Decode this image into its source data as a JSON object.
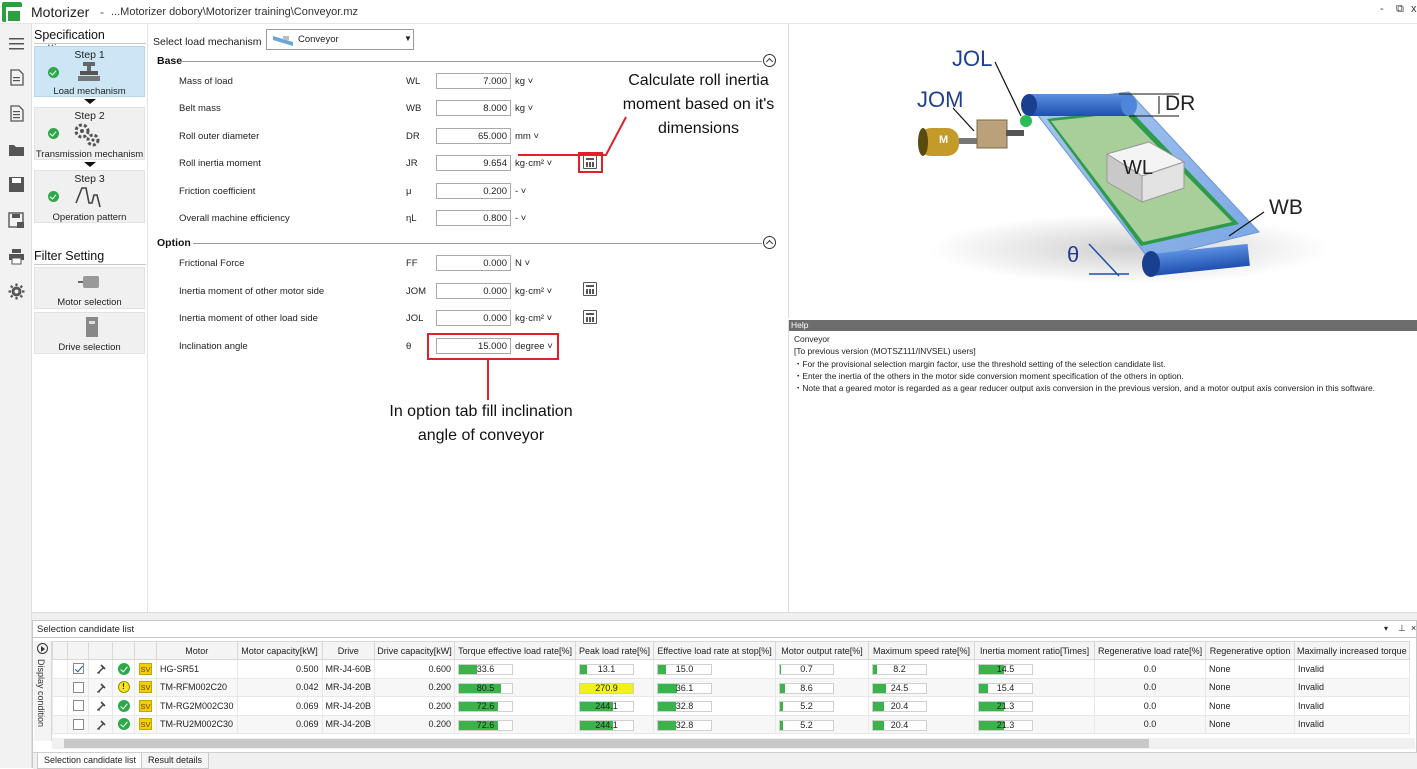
{
  "window": {
    "app_title": "Motorizer",
    "separator": "-",
    "file_path": "...Motorizer dobory\\Motorizer training\\Conveyor.mz",
    "min_label": "-",
    "restore_label": "⧉",
    "close_label": "x"
  },
  "nav": {
    "spec_heading": "Specification settings",
    "steps": [
      {
        "title": "Step 1",
        "label": "Load mechanism"
      },
      {
        "title": "Step 2",
        "label": "Transmission mechanism"
      },
      {
        "title": "Step 3",
        "label": "Operation pattern"
      }
    ],
    "filter_heading": "Filter Setting",
    "filters": [
      {
        "label": "Motor selection"
      },
      {
        "label": "Drive selection"
      }
    ]
  },
  "form": {
    "select_label": "Select load mechanism",
    "select_value": "Conveyor",
    "base_heading": "Base",
    "option_heading": "Option",
    "base_rows": [
      {
        "label": "Mass of load",
        "symbol": "WL",
        "value": "7.000",
        "unit": "kg"
      },
      {
        "label": "Belt mass",
        "symbol": "WB",
        "value": "8.000",
        "unit": "kg"
      },
      {
        "label": "Roll outer diameter",
        "symbol": "DR",
        "value": "65.000",
        "unit": "mm"
      },
      {
        "label": "Roll inertia moment",
        "symbol": "JR",
        "value": "9.654",
        "unit": "kg·cm²"
      },
      {
        "label": "Friction coefficient",
        "symbol": "μ",
        "value": "0.200",
        "unit": "-"
      },
      {
        "label": "Overall machine efficiency",
        "symbol": "ηL",
        "value": "0.800",
        "unit": "-"
      }
    ],
    "option_rows": [
      {
        "label": "Frictional Force",
        "symbol": "FF",
        "value": "0.000",
        "unit": "N"
      },
      {
        "label": "Inertia moment of other motor side",
        "symbol": "JOM",
        "value": "0.000",
        "unit": "kg·cm²"
      },
      {
        "label": "Inertia moment of other load side",
        "symbol": "JOL",
        "value": "0.000",
        "unit": "kg·cm²"
      },
      {
        "label": "Inclination angle",
        "symbol": "θ",
        "value": "15.000",
        "unit": "degree"
      }
    ]
  },
  "annotations": {
    "roll_inertia_line1": "Calculate roll inertia",
    "roll_inertia_line2": "moment based on it's",
    "roll_inertia_line3": "dimensions",
    "inclination_line1": "In option tab fill inclination",
    "inclination_line2": "angle of conveyor"
  },
  "diagram": {
    "jol": "JOL",
    "jom": "JOM",
    "dr": "DR",
    "wl": "WL",
    "wb": "WB",
    "theta": "θ",
    "motor_letter": "M"
  },
  "help": {
    "heading": "Help",
    "lines": [
      "Conveyor",
      "  [To previous version (MOTSZ111/INVSEL) users]",
      "  ・For the provisional selection margin factor, use the threshold setting of the selection candidate list.",
      "  ・Enter the inertia of the others in the motor side conversion moment specification of the others in option.",
      "  ・Note that a geared motor is regarded as a gear reducer output axis conversion in the previous version, and a motor output axis conversion in this software."
    ]
  },
  "candidates": {
    "panel_title": "Selection candidate list",
    "side_tab": "Display condition",
    "columns": [
      "Motor",
      "Motor capacity[kW]",
      "Drive",
      "Drive capacity[kW]",
      "Torque effective load rate[%]",
      "Peak load rate[%]",
      "Effective load rate at stop[%]",
      "Motor output rate[%]",
      "Maximum speed rate[%]",
      "Inertia moment ratio[Times]",
      "Regenerative load rate[%]",
      "Regenerative option",
      "Maximally increased torque"
    ],
    "rows": [
      {
        "checked": true,
        "status": "ok",
        "motor": "HG-SR51",
        "motor_cap": "0.500",
        "drive": "MR-J4-60B",
        "drive_cap": "0.600",
        "torque": "33.6",
        "torque_pct": 34,
        "peak": "13.1",
        "peak_pct": 13,
        "peak_warn": false,
        "stop": "15.0",
        "stop_pct": 15,
        "output": "0.7",
        "output_pct": 1,
        "speed": "8.2",
        "speed_pct": 8,
        "inertia": "14.5",
        "inertia_pct": 48,
        "regen": "0.0",
        "regen_opt": "None",
        "maxtorque": "Invalid"
      },
      {
        "checked": false,
        "status": "warn",
        "motor": "TM-RFM002C20",
        "motor_cap": "0.042",
        "drive": "MR-J4-20B",
        "drive_cap": "0.200",
        "torque": "80.5",
        "torque_pct": 80,
        "peak": "270.9",
        "peak_pct": 100,
        "peak_warn": true,
        "stop": "36.1",
        "stop_pct": 36,
        "output": "8.6",
        "output_pct": 9,
        "speed": "24.5",
        "speed_pct": 24,
        "inertia": "15.4",
        "inertia_pct": 16,
        "regen": "0.0",
        "regen_opt": "None",
        "maxtorque": "Invalid"
      },
      {
        "checked": false,
        "status": "ok",
        "motor": "TM-RG2M002C30",
        "motor_cap": "0.069",
        "drive": "MR-J4-20B",
        "drive_cap": "0.200",
        "torque": "72.6",
        "torque_pct": 73,
        "peak": "244.1",
        "peak_pct": 62,
        "peak_warn": false,
        "stop": "32.8",
        "stop_pct": 33,
        "output": "5.2",
        "output_pct": 5,
        "speed": "20.4",
        "speed_pct": 20,
        "inertia": "21.3",
        "inertia_pct": 48,
        "regen": "0.0",
        "regen_opt": "None",
        "maxtorque": "Invalid"
      },
      {
        "checked": false,
        "status": "ok",
        "motor": "TM-RU2M002C30",
        "motor_cap": "0.069",
        "drive": "MR-J4-20B",
        "drive_cap": "0.200",
        "torque": "72.6",
        "torque_pct": 73,
        "peak": "244.1",
        "peak_pct": 62,
        "peak_warn": false,
        "stop": "32.8",
        "stop_pct": 33,
        "output": "5.2",
        "output_pct": 5,
        "speed": "20.4",
        "speed_pct": 20,
        "inertia": "21.3",
        "inertia_pct": 48,
        "regen": "0.0",
        "regen_opt": "None",
        "maxtorque": "Invalid"
      }
    ],
    "tabs": [
      "Selection candidate list",
      "Result details"
    ],
    "sv_label": "SV",
    "warn_label": "!"
  },
  "colors": {
    "accent_red": "#e0202a",
    "bar_green": "#3bb34a",
    "bar_warn": "#f2f219",
    "active_step": "#cde6f5"
  }
}
